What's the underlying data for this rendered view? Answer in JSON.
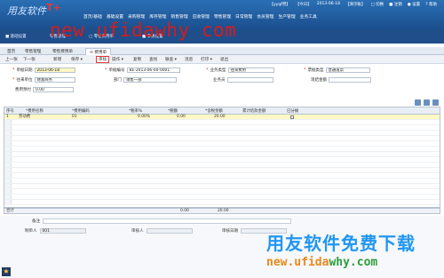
{
  "header": {
    "logo_text": "用友软件",
    "logo_mark": "T+",
    "status": [
      "【yyqf用】",
      "【今日】",
      "2013-06-18",
      "【演示账】",
      "□ 切换",
      "■ 注销",
      "● 设置",
      "? 帮助"
    ],
    "modules": [
      "首页/基础",
      "基础设置",
      "采购管理",
      "库存管理",
      "销售管理",
      "应收管理",
      "零售管理",
      "日常管理",
      "会员管理",
      "生产管理",
      "业务工具"
    ]
  },
  "watermark_top": "new ufidawhy com",
  "nav": [
    "■ 基础设置",
    "零售管理",
    "□ 零售费用单",
    "■ 参数设置"
  ],
  "tabs": [
    {
      "label": "首页",
      "active": false
    },
    {
      "label": "零售管理",
      "active": false
    },
    {
      "label": "零售费用单",
      "active": false
    },
    {
      "label": "⊙ 费用单",
      "active": true
    }
  ],
  "toolbar": [
    "上一张",
    "下一张",
    "新增",
    "保存 ▾",
    "审核",
    "操作 ▾",
    "复制",
    "查找",
    "联查 ▾",
    "消息",
    "打印 ▾",
    "退出"
  ],
  "form": {
    "date_label": "单据日期",
    "date_value": "2013-06-18",
    "code_label": "单据编号",
    "code_value": "BE-2013-06-00-0001",
    "biztype_label": "业务类型",
    "biztype_value": "往来费用",
    "srctype_label": "票据类型",
    "srctype_value": "普通发票",
    "unit_label": "往来单位",
    "unit_value": "财富商务",
    "dept_label": "部门",
    "dept_value": "销售一部",
    "staff_label": "业务员",
    "staff_value": "",
    "project_label": "现结金额",
    "project_value": "",
    "prepay_label": "费用预付",
    "prepay_value": "0.00"
  },
  "grid": {
    "headers": [
      "序号",
      "*费用名称",
      "*费用编码",
      "*税率%",
      "*税额",
      "*含税金额",
      "累计结款金额",
      "已分摊"
    ],
    "rows": [
      {
        "num": "1",
        "name": "劳动费",
        "code": "01",
        "rate": "0.00%",
        "tax": "0.00",
        "amount": "20.00",
        "settled": "",
        "alloc": ""
      }
    ],
    "empty_rows": 16,
    "total_label": "合计",
    "total_tax": "0.00",
    "total_amount": "20.00"
  },
  "footer": {
    "memo_label": "备注",
    "maker_label": "制单人",
    "maker_value": "001",
    "auditor_label": "审核人",
    "auditor_value": "",
    "audit_date_label": "审核日期",
    "audit_date_value": ""
  },
  "watermark_cn": "用友软件免费下载",
  "watermark_url_a": "new.ufida",
  "watermark_url_b": "why.com"
}
